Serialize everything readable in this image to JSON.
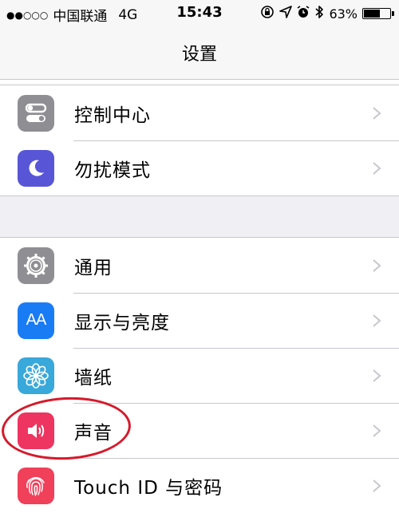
{
  "status_bar": {
    "signal": "●●○○○",
    "carrier": "中国联通",
    "network": "4G",
    "time": "15:43",
    "battery_percent": "63%",
    "battery_level": 0.63,
    "icons": [
      "orientation-lock-icon",
      "location-arrow-icon",
      "alarm-icon",
      "bluetooth-icon",
      "battery-icon"
    ]
  },
  "nav": {
    "title": "设置"
  },
  "group1": [
    {
      "label": "控制中心",
      "icon": "control-center-icon",
      "color": "#8e8e93"
    },
    {
      "label": "勿扰模式",
      "icon": "moon-icon",
      "color": "#5856d6"
    }
  ],
  "group2": [
    {
      "label": "通用",
      "icon": "gear-icon",
      "color": "#8e8e93"
    },
    {
      "label": "显示与亮度",
      "icon": "aa-icon",
      "color": "#1a7cf5",
      "icon_text": "AA"
    },
    {
      "label": "墙纸",
      "icon": "flower-icon",
      "color": "#39a8da"
    },
    {
      "label": "声音",
      "icon": "speaker-icon",
      "color": "#ee3460"
    },
    {
      "label": "Touch ID 与密码",
      "icon": "fingerprint-icon",
      "color": "#f0405a"
    }
  ],
  "annotation": {
    "color": "#d6192b"
  }
}
